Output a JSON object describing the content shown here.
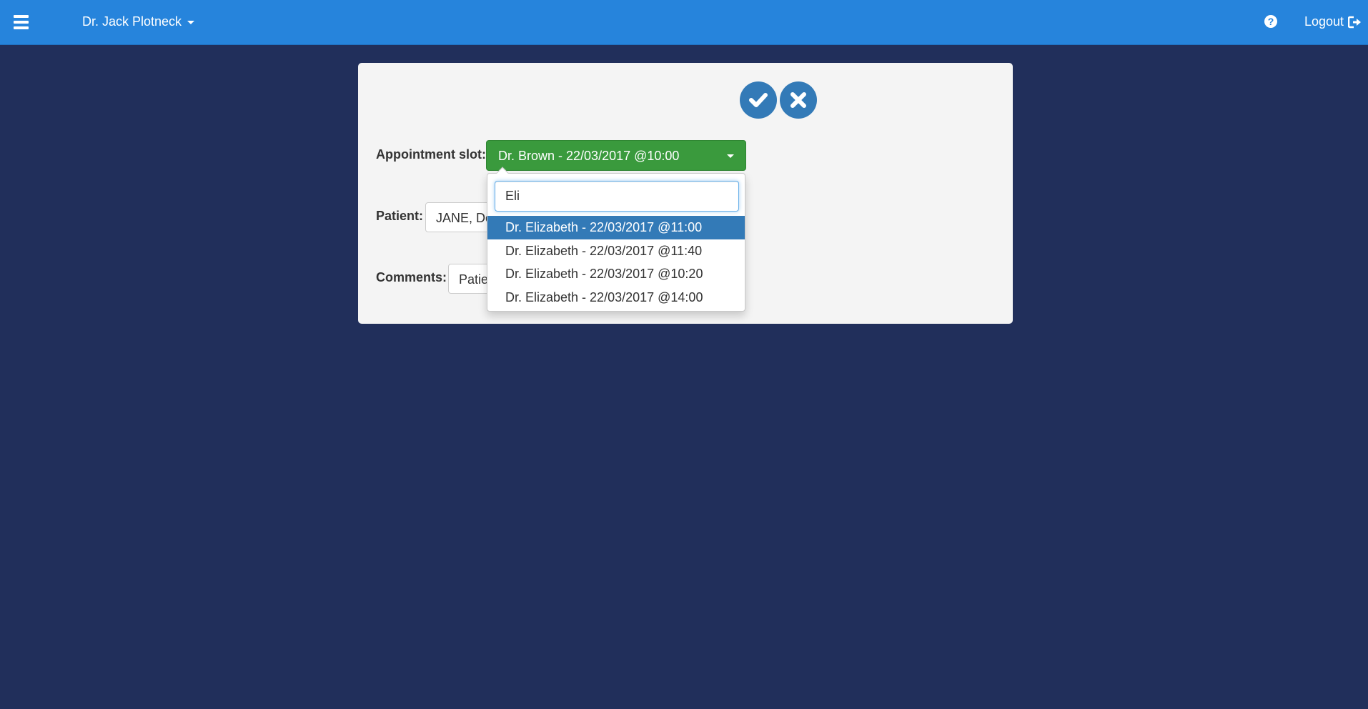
{
  "topbar": {
    "menu_icon": "hamburger-menu-icon",
    "user_name": "Dr. Jack Plotneck",
    "help_symbol": "?",
    "logout_label": "Logout",
    "bar_color": "#2684dc"
  },
  "form": {
    "confirm_icon": "checkmark-icon",
    "cancel_icon": "x-icon",
    "slot_label": "Appointment slot:",
    "slot_value": "Dr. Brown - 22/03/2017 @10:00",
    "patient_label": "Patient:",
    "patient_value": "JANE, Do",
    "comments_label": "Comments:",
    "comments_value": "Patie",
    "slot_color": "#3a9a3d",
    "action_color": "#337ab7"
  },
  "dropdown": {
    "search_value": "Eli",
    "options": [
      {
        "label": "Dr. Elizabeth - 22/03/2017 @11:00",
        "active": true
      },
      {
        "label": "Dr. Elizabeth - 22/03/2017 @11:40",
        "active": false
      },
      {
        "label": "Dr. Elizabeth - 22/03/2017 @10:20",
        "active": false
      },
      {
        "label": "Dr. Elizabeth - 22/03/2017 @14:00",
        "active": false
      }
    ]
  },
  "page_background": "#212f5b"
}
